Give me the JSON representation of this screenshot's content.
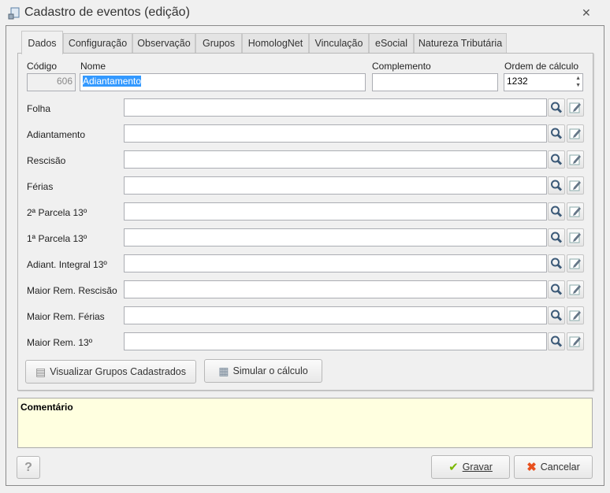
{
  "window": {
    "title": "Cadastro de eventos (edição)",
    "close_icon": "close-icon"
  },
  "tabs": [
    "Dados",
    "Configuração",
    "Observação",
    "Grupos",
    "HomologNet",
    "Vinculação",
    "eSocial",
    "Natureza Tributária"
  ],
  "fields": {
    "codigo": {
      "label": "Código",
      "value": "606"
    },
    "nome": {
      "label": "Nome",
      "value": "Adiantamento"
    },
    "complemento": {
      "label": "Complemento",
      "value": ""
    },
    "ordem": {
      "label": "Ordem de cálculo",
      "value": "1232"
    }
  },
  "rows": [
    {
      "label": "Folha"
    },
    {
      "label": "Adiantamento"
    },
    {
      "label": "Rescisão"
    },
    {
      "label": "Férias"
    },
    {
      "label": "2ª Parcela 13º"
    },
    {
      "label": "1ª Parcela 13º"
    },
    {
      "label": "Adiant. Integral 13º"
    },
    {
      "label": "Maior Rem. Rescisão"
    },
    {
      "label": "Maior Rem. Férias"
    },
    {
      "label": "Maior Rem. 13º"
    }
  ],
  "buttons": {
    "visualizar": "Visualizar Grupos Cadastrados",
    "simular": "Simular o cálculo",
    "help": "?",
    "gravar": "Gravar",
    "cancelar": "Cancelar"
  },
  "comment": {
    "label": "Comentário"
  },
  "colors": {
    "selection": "#3399ff",
    "comment_bg": "#ffffe0",
    "check": "#7ab800",
    "cancel": "#e8501e"
  }
}
